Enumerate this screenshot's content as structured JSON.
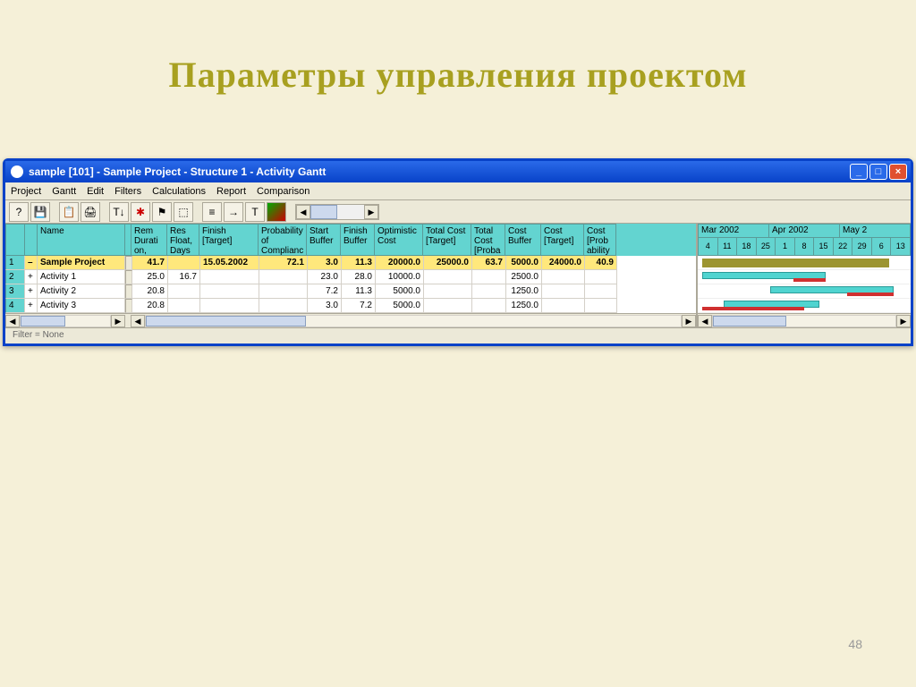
{
  "slide": {
    "title": "Параметры управления проектом",
    "number": "48"
  },
  "window": {
    "title": "sample [101] - Sample Project - Structure 1 - Activity Gantt",
    "menu": [
      "Project",
      "Gantt",
      "Edit",
      "Filters",
      "Calculations",
      "Report",
      "Comparison"
    ],
    "footer": "Filter = None"
  },
  "columns": [
    {
      "key": "name",
      "label": "Name",
      "w": "c-name"
    },
    {
      "key": "rem",
      "label": "Rem Durati on,",
      "w": "c-rem",
      "num": true
    },
    {
      "key": "resf",
      "label": "Res Float, Days",
      "w": "c-resf",
      "num": true
    },
    {
      "key": "fin",
      "label": "Finish [Target]",
      "w": "c-fin"
    },
    {
      "key": "prob",
      "label": "Probability of Complianc",
      "w": "c-prob",
      "num": true
    },
    {
      "key": "sbuf",
      "label": "Start Buffer",
      "w": "c-sbuf",
      "num": true
    },
    {
      "key": "fbuf",
      "label": "Finish Buffer",
      "w": "c-fbuf",
      "num": true
    },
    {
      "key": "opt",
      "label": "Optimistic Cost",
      "w": "c-opt",
      "num": true
    },
    {
      "key": "tct",
      "label": "Total Cost [Target]",
      "w": "c-tct",
      "num": true
    },
    {
      "key": "tcp",
      "label": "Total Cost [Proba",
      "w": "c-tcp",
      "num": true
    },
    {
      "key": "cbuf",
      "label": "Cost Buffer",
      "w": "c-cbuf",
      "num": true
    },
    {
      "key": "ctg",
      "label": "Cost [Target]",
      "w": "c-ctg",
      "num": true
    },
    {
      "key": "cpr",
      "label": "Cost [Prob ability",
      "w": "c-cpr",
      "num": true
    }
  ],
  "rows": [
    {
      "n": "1",
      "exp": "–",
      "bold": true,
      "name": "Sample Project",
      "rem": "41.7",
      "resf": "",
      "fin": "15.05.2002",
      "prob": "72.1",
      "sbuf": "3.0",
      "fbuf": "11.3",
      "opt": "20000.0",
      "tct": "25000.0",
      "tcp": "63.7",
      "cbuf": "5000.0",
      "ctg": "24000.0",
      "cpr": "40.9"
    },
    {
      "n": "2",
      "exp": "+",
      "bold": false,
      "name": "Activity 1",
      "rem": "25.0",
      "resf": "16.7",
      "fin": "",
      "prob": "",
      "sbuf": "23.0",
      "fbuf": "28.0",
      "opt": "10000.0",
      "tct": "",
      "tcp": "",
      "cbuf": "2500.0",
      "ctg": "",
      "cpr": ""
    },
    {
      "n": "3",
      "exp": "+",
      "bold": false,
      "name": "Activity 2",
      "rem": "20.8",
      "resf": "",
      "fin": "",
      "prob": "",
      "sbuf": "7.2",
      "fbuf": "11.3",
      "opt": "5000.0",
      "tct": "",
      "tcp": "",
      "cbuf": "1250.0",
      "ctg": "",
      "cpr": ""
    },
    {
      "n": "4",
      "exp": "+",
      "bold": false,
      "name": "Activity 3",
      "rem": "20.8",
      "resf": "",
      "fin": "",
      "prob": "",
      "sbuf": "3.0",
      "fbuf": "7.2",
      "opt": "5000.0",
      "tct": "",
      "tcp": "",
      "cbuf": "1250.0",
      "ctg": "",
      "cpr": ""
    }
  ],
  "gantt": {
    "months": [
      "Mar 2002",
      "Apr 2002",
      "May 2"
    ],
    "days": [
      "4",
      "11",
      "18",
      "25",
      "1",
      "8",
      "15",
      "22",
      "29",
      "6",
      "13"
    ]
  }
}
